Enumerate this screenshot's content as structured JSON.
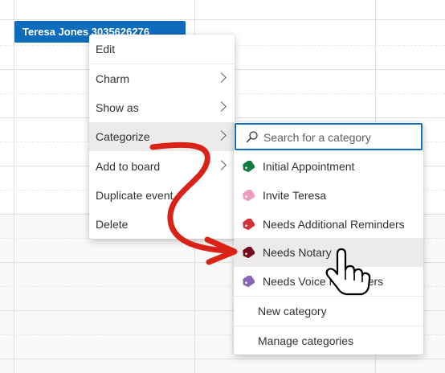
{
  "event": {
    "title": "Teresa Jones 3035626276",
    "color": "#0f6cbd"
  },
  "context_menu": {
    "items": [
      {
        "label": "Edit"
      },
      {
        "label": "Charm"
      },
      {
        "label": "Show as"
      },
      {
        "label": "Categorize"
      },
      {
        "label": "Add to board"
      },
      {
        "label": "Duplicate event"
      },
      {
        "label": "Delete"
      }
    ]
  },
  "categorize_menu": {
    "search": {
      "placeholder": "Search for a category",
      "value": ""
    },
    "categories": [
      {
        "label": "Initial Appointment",
        "color": "#107c41"
      },
      {
        "label": "Invite Teresa",
        "color": "#f09ac0"
      },
      {
        "label": "Needs Additional Reminders",
        "color": "#d13438"
      },
      {
        "label": "Needs Notary",
        "color": "#750b1c"
      },
      {
        "label": "Needs Voice Reminders",
        "color": "#8764b8"
      }
    ],
    "new_category": "New category",
    "manage_categories": "Manage categories"
  },
  "annotation": {
    "arrow_color": "#d92318"
  }
}
